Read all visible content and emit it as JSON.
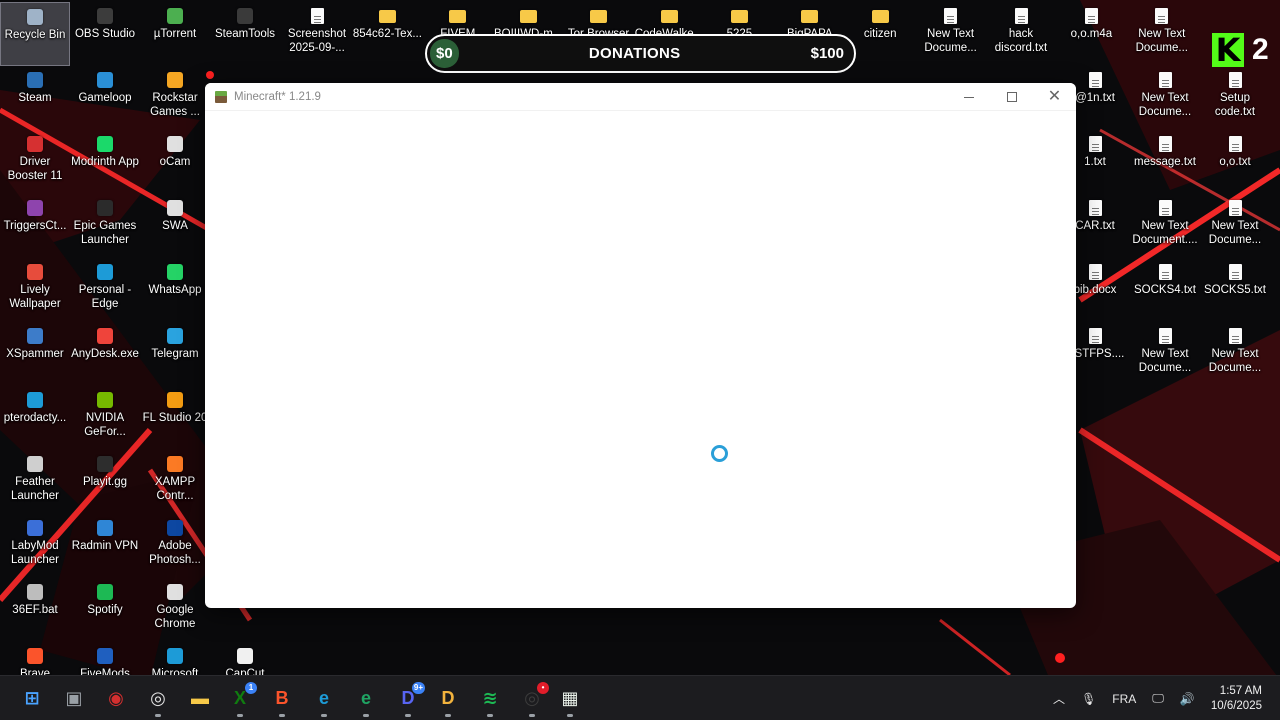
{
  "desktop": {
    "col1": [
      {
        "label": "Recycle Bin",
        "icon": "recycle-bin-icon",
        "color": "#9fb3c8",
        "selected": true
      },
      {
        "label": "Steam",
        "icon": "steam-icon",
        "color": "#2a6fb5"
      },
      {
        "label": "Driver Booster 11",
        "icon": "driver-booster-icon",
        "color": "#d63031"
      },
      {
        "label": "TriggersCt...",
        "icon": "rar-icon",
        "color": "#8e44ad"
      },
      {
        "label": "Lively Wallpaper",
        "icon": "lively-icon",
        "color": "#e74c3c"
      },
      {
        "label": "XSpammer",
        "icon": "app-icon",
        "color": "#3d7cc9"
      },
      {
        "label": "pterodacty...",
        "icon": "edge-icon",
        "color": "#1d9bd7"
      },
      {
        "label": "Feather Launcher",
        "icon": "feather-icon",
        "color": "#cfcfcf"
      },
      {
        "label": "LabyMod Launcher",
        "icon": "labymod-icon",
        "color": "#3b6fd8"
      },
      {
        "label": "36EF.bat",
        "icon": "bat-icon",
        "color": "#bdbdbd"
      },
      {
        "label": "Brave",
        "icon": "brave-icon",
        "color": "#fb542b"
      }
    ],
    "col2": [
      {
        "label": "OBS Studio",
        "icon": "obs-icon",
        "color": "#3c3c3c"
      },
      {
        "label": "Gameloop",
        "icon": "gameloop-icon",
        "color": "#2a8fd6"
      },
      {
        "label": "Modrinth App",
        "icon": "modrinth-icon",
        "color": "#1bd96a"
      },
      {
        "label": "Epic Games Launcher",
        "icon": "epic-icon",
        "color": "#2b2b2b"
      },
      {
        "label": "Personal - Edge",
        "icon": "edge-icon",
        "color": "#1d9bd7"
      },
      {
        "label": "AnyDesk.exe",
        "icon": "anydesk-icon",
        "color": "#ef443b"
      },
      {
        "label": "NVIDIA GeFor...",
        "icon": "nvidia-icon",
        "color": "#76b900"
      },
      {
        "label": "Playit.gg",
        "icon": "playit-icon",
        "color": "#2d2d2d"
      },
      {
        "label": "Radmin VPN",
        "icon": "radmin-icon",
        "color": "#2f86d6"
      },
      {
        "label": "Spotify",
        "icon": "spotify-icon",
        "color": "#1db954"
      },
      {
        "label": "FiveMods",
        "icon": "fivemods-icon",
        "color": "#1f5fbf"
      }
    ],
    "col3": [
      {
        "label": "µTorrent",
        "icon": "utorrent-icon",
        "color": "#4caf50"
      },
      {
        "label": "Rockstar Games ...",
        "icon": "rockstar-icon",
        "color": "#f5a623"
      },
      {
        "label": "oCam",
        "icon": "ocam-icon",
        "color": "#e0e0e0"
      },
      {
        "label": "SWA",
        "icon": "app-icon",
        "color": "#e0e0e0"
      },
      {
        "label": "WhatsApp",
        "icon": "whatsapp-icon",
        "color": "#25d366"
      },
      {
        "label": "Telegram",
        "icon": "telegram-icon",
        "color": "#2aa3df"
      },
      {
        "label": "FL Studio 20",
        "icon": "flstudio-icon",
        "color": "#f39c12"
      },
      {
        "label": "XAMPP Contr...",
        "icon": "xampp-icon",
        "color": "#fb7a24"
      },
      {
        "label": "Adobe Photosh...",
        "icon": "photoshop-icon",
        "color": "#0d47a1"
      },
      {
        "label": "Google Chrome",
        "icon": "chrome-icon",
        "color": "#e0e0e0"
      },
      {
        "label": "Microsoft",
        "icon": "edge-icon",
        "color": "#1d9bd7"
      }
    ],
    "col4": [
      {
        "label": "SteamTools",
        "icon": "steamtools-icon",
        "color": "#3a3a3a"
      },
      {
        "label": "CapCut",
        "icon": "capcut-icon",
        "color": "#f0f0f0"
      }
    ],
    "top_row": [
      {
        "label": "Screenshot 2025-09-...",
        "icon": "doc-icon",
        "type": "doc"
      },
      {
        "label": "854c62-Tex...",
        "icon": "folder-icon",
        "type": "folder"
      },
      {
        "label": "FIVEM",
        "icon": "folder-icon",
        "type": "folder"
      },
      {
        "label": "BOIIIWD-m...",
        "icon": "folder-icon",
        "type": "folder"
      },
      {
        "label": "Tor Browser",
        "icon": "folder-icon",
        "type": "folder"
      },
      {
        "label": "CodeWalke...",
        "icon": "folder-icon",
        "type": "folder"
      },
      {
        "label": "5225",
        "icon": "folder-icon",
        "type": "folder"
      },
      {
        "label": "BigPAPA",
        "icon": "folder-icon",
        "type": "folder"
      },
      {
        "label": "citizen",
        "icon": "folder-icon",
        "type": "folder"
      },
      {
        "label": "New Text Docume...",
        "icon": "doc-icon",
        "type": "doc"
      },
      {
        "label": "hack discord.txt",
        "icon": "doc-icon",
        "type": "doc"
      },
      {
        "label": "o,o.m4a",
        "icon": "audio-icon",
        "type": "doc"
      },
      {
        "label": "New Text Docume...",
        "icon": "doc-icon",
        "type": "doc"
      }
    ],
    "right_cols": [
      {
        "label": "@1n.txt",
        "icon": "doc-icon"
      },
      {
        "label": "New Text Docume...",
        "icon": "doc-icon"
      },
      {
        "label": "Setup code.txt",
        "icon": "doc-icon"
      },
      {
        "label": "1.txt",
        "icon": "doc-icon"
      },
      {
        "label": "message.txt",
        "icon": "doc-icon"
      },
      {
        "label": "o,o.txt",
        "icon": "doc-icon"
      },
      {
        "label": "CAR.txt",
        "icon": "doc-icon"
      },
      {
        "label": "New Text Document....",
        "icon": "doc-icon"
      },
      {
        "label": "New Text Docume...",
        "icon": "doc-icon"
      },
      {
        "label": "bib.docx",
        "icon": "word-icon"
      },
      {
        "label": "SOCKS4.txt",
        "icon": "doc-icon"
      },
      {
        "label": "SOCKS5.txt",
        "icon": "doc-icon"
      },
      {
        "label": "OSTFPS....",
        "icon": "doc-icon"
      },
      {
        "label": "New Text Docume...",
        "icon": "doc-icon"
      },
      {
        "label": "New Text Docume...",
        "icon": "doc-icon"
      }
    ]
  },
  "donation": {
    "title": "DONATIONS",
    "start": "$0",
    "goal": "$100",
    "progress": 0.0
  },
  "stream_logo": {
    "letter": "K",
    "number": "2",
    "color": "#53fc18"
  },
  "window": {
    "title": "Minecraft* 1.21.9",
    "minimize_label": "Minimize",
    "maximize_label": "Maximize",
    "close_label": "Close",
    "loading": true,
    "spinner_color": "#2a9fd8"
  },
  "taskbar": {
    "apps": [
      {
        "name": "start-button",
        "glyph": "⊞",
        "color": "#4aa3ff"
      },
      {
        "name": "task-view",
        "glyph": "▣",
        "color": "#9aa0a6"
      },
      {
        "name": "app-red",
        "glyph": "◉",
        "color": "#d32f2f"
      },
      {
        "name": "obs",
        "glyph": "◎",
        "color": "#e0e0e0"
      },
      {
        "name": "file-explorer",
        "glyph": "▬",
        "color": "#f7c948"
      },
      {
        "name": "xbox",
        "glyph": "X",
        "color": "#107c10",
        "badge": "1"
      },
      {
        "name": "brave",
        "glyph": "B",
        "color": "#fb542b"
      },
      {
        "name": "edge",
        "glyph": "e",
        "color": "#1d9bd7"
      },
      {
        "name": "edge-2",
        "glyph": "e",
        "color": "#1fa463"
      },
      {
        "name": "discord",
        "glyph": "D",
        "color": "#5865f2",
        "badge": "9+"
      },
      {
        "name": "discord-canary",
        "glyph": "D",
        "color": "#f2b33d"
      },
      {
        "name": "spotify",
        "glyph": "≋",
        "color": "#1db954"
      },
      {
        "name": "obs-2",
        "glyph": "◎",
        "color": "#3c3c3c",
        "badge": "•"
      },
      {
        "name": "minecraft",
        "glyph": "▦",
        "color": "#e8f0e8"
      }
    ],
    "tray": {
      "lang": "FRA",
      "time": "1:57 AM",
      "date": "10/6/2025"
    }
  }
}
